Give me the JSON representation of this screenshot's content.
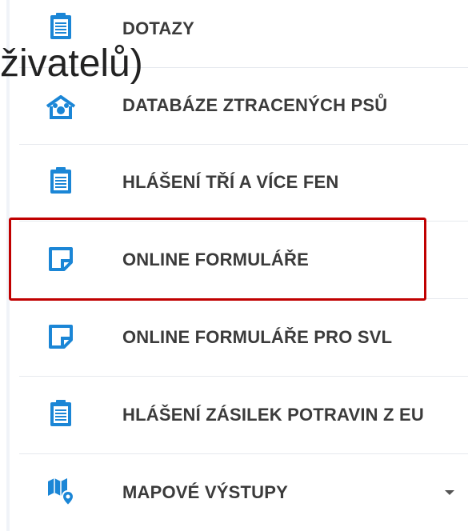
{
  "menu": {
    "items": [
      {
        "label": "DOTAZY",
        "icon": "clipboard-icon"
      },
      {
        "label": "DATABÁZE ZTRACENÝCH PSŮ",
        "icon": "dog-house-icon"
      },
      {
        "label": "HLÁŠENÍ TŘÍ A VÍCE FEN",
        "icon": "clipboard-icon"
      },
      {
        "label": "ONLINE FORMULÁŘE",
        "icon": "form-note-icon"
      },
      {
        "label": "ONLINE FORMULÁŘE PRO SVL",
        "icon": "form-note-icon"
      },
      {
        "label": "HLÁŠENÍ ZÁSILEK POTRAVIN Z EU",
        "icon": "clipboard-icon"
      },
      {
        "label": "MAPOVÉ VÝSTUPY",
        "icon": "map-pin-icon",
        "has_dropdown": true
      }
    ]
  },
  "overlay": {
    "fragment_text": "živatelů)"
  },
  "colors": {
    "icon_blue": "#1b86d6",
    "highlight_red": "#c00000",
    "label_text": "#3b3b3b",
    "divider": "#e6e9ee"
  }
}
